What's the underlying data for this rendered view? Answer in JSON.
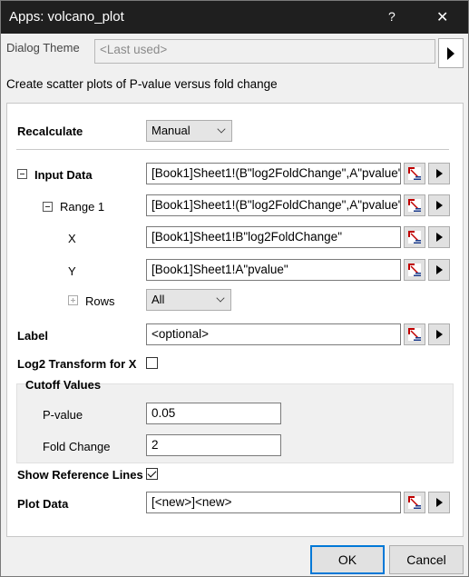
{
  "window": {
    "title": "Apps: volcano_plot",
    "help": "?",
    "close": "✕"
  },
  "theme": {
    "label": "Dialog Theme",
    "placeholder": "<Last used>"
  },
  "description": "Create scatter plots of P-value versus fold change",
  "recalculate": {
    "label": "Recalculate",
    "value": "Manual"
  },
  "input_data": {
    "label": "Input Data",
    "value": "[Book1]Sheet1!(B\"log2FoldChange\",A\"pvalue\")"
  },
  "range1": {
    "label": "Range 1",
    "value": "[Book1]Sheet1!(B\"log2FoldChange\",A\"pvalue\")"
  },
  "x": {
    "label": "X",
    "value": "[Book1]Sheet1!B\"log2FoldChange\""
  },
  "y": {
    "label": "Y",
    "value": "[Book1]Sheet1!A\"pvalue\""
  },
  "rows": {
    "label": "Rows",
    "value": "All"
  },
  "label_field": {
    "label": "Label",
    "value": "<optional>"
  },
  "log2": {
    "label": "Log2 Transform for X",
    "checked": false
  },
  "cutoff": {
    "title": "Cutoff Values",
    "pvalue_label": "P-value",
    "pvalue": "0.05",
    "fold_label": "Fold Change",
    "fold": "2"
  },
  "reference": {
    "label": "Show Reference Lines",
    "checked": true
  },
  "plot_data": {
    "label": "Plot Data",
    "value": "[<new>]<new>"
  },
  "buttons": {
    "ok": "OK",
    "cancel": "Cancel"
  }
}
